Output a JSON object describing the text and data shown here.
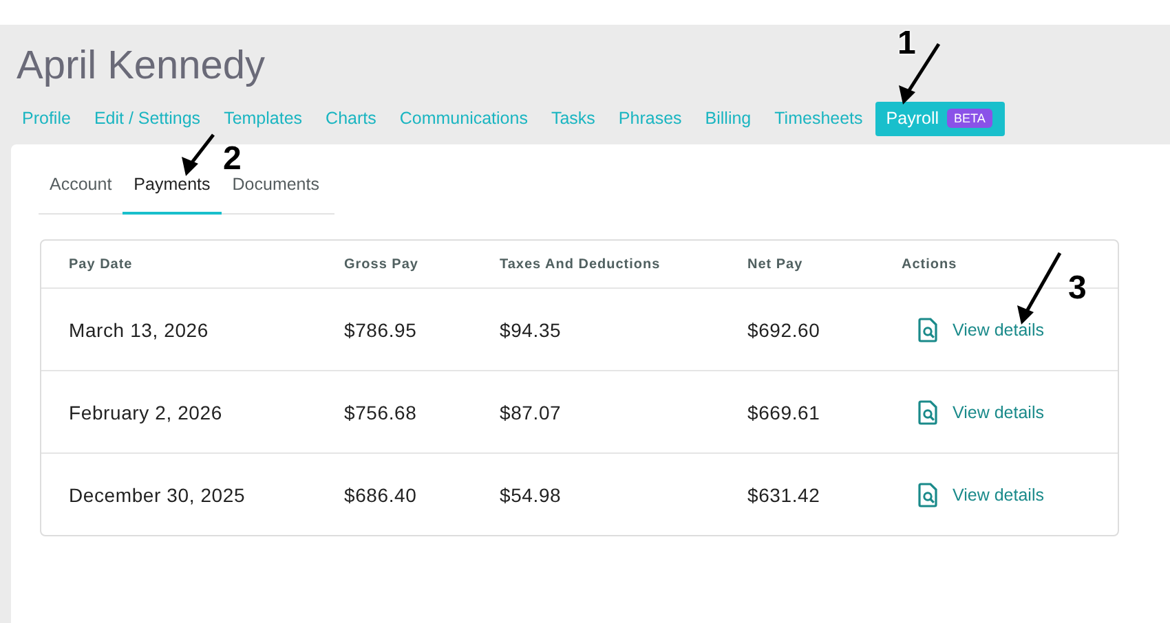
{
  "page_title": "April Kennedy",
  "nav_tabs": [
    {
      "label": "Profile",
      "selected": false
    },
    {
      "label": "Edit / Settings",
      "selected": false
    },
    {
      "label": "Templates",
      "selected": false
    },
    {
      "label": "Charts",
      "selected": false
    },
    {
      "label": "Communications",
      "selected": false
    },
    {
      "label": "Tasks",
      "selected": false
    },
    {
      "label": "Phrases",
      "selected": false
    },
    {
      "label": "Billing",
      "selected": false
    },
    {
      "label": "Timesheets",
      "selected": false
    },
    {
      "label": "Payroll",
      "badge": "BETA",
      "selected": true
    }
  ],
  "sub_tabs": [
    {
      "label": "Account",
      "selected": false
    },
    {
      "label": "Payments",
      "selected": true
    },
    {
      "label": "Documents",
      "selected": false
    }
  ],
  "table": {
    "columns": [
      "Pay Date",
      "Gross Pay",
      "Taxes And Deductions",
      "Net Pay",
      "Actions"
    ],
    "rows": [
      {
        "pay_date": "March 13, 2026",
        "gross_pay": "$786.95",
        "taxes": "$94.35",
        "net_pay": "$692.60",
        "action": "View details"
      },
      {
        "pay_date": "February 2, 2026",
        "gross_pay": "$756.68",
        "taxes": "$87.07",
        "net_pay": "$669.61",
        "action": "View details"
      },
      {
        "pay_date": "December 30, 2025",
        "gross_pay": "$686.40",
        "taxes": "$54.98",
        "net_pay": "$631.42",
        "action": "View details"
      }
    ]
  },
  "annotations": [
    {
      "label": "1"
    },
    {
      "label": "2"
    },
    {
      "label": "3"
    }
  ]
}
